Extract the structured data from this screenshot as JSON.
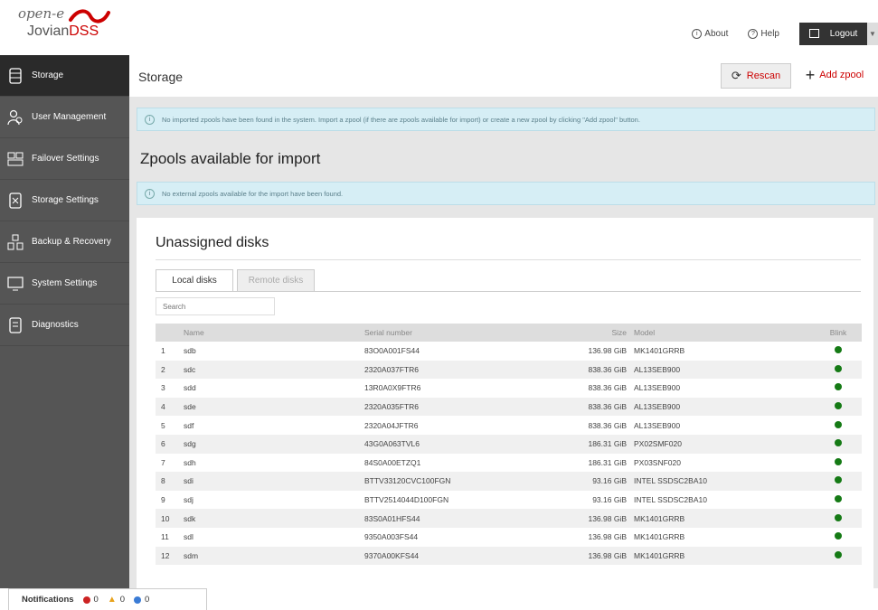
{
  "header": {
    "logo_brand": "open-e",
    "logo_product_prefix": "Jovian",
    "logo_product_suffix": "DSS",
    "about_label": "About",
    "help_label": "Help",
    "logout_label": "Logout"
  },
  "sidebar": {
    "items": [
      {
        "label": "Storage",
        "icon": "storage-icon",
        "active": true
      },
      {
        "label": "User Management",
        "icon": "users-icon",
        "active": false
      },
      {
        "label": "Failover Settings",
        "icon": "failover-icon",
        "active": false
      },
      {
        "label": "Storage Settings",
        "icon": "storage-settings-icon",
        "active": false
      },
      {
        "label": "Backup & Recovery",
        "icon": "backup-icon",
        "active": false
      },
      {
        "label": "System Settings",
        "icon": "system-settings-icon",
        "active": false
      },
      {
        "label": "Diagnostics",
        "icon": "diagnostics-icon",
        "active": false
      }
    ]
  },
  "main": {
    "page_title": "Storage",
    "rescan_label": "Rescan",
    "add_zpool_label": "Add zpool",
    "info_no_imported": "No imported zpools have been found in the system. Import a zpool (if there are zpools available for import) or create a new zpool by clicking \"Add zpool\" button.",
    "section_import_title": "Zpools available for import",
    "info_no_external": "No external zpools available for the import have been found.",
    "unassigned": {
      "title": "Unassigned disks",
      "tabs": [
        "Local disks",
        "Remote disks"
      ],
      "search_placeholder": "Search",
      "columns": [
        "Name",
        "Serial number",
        "Size",
        "Model",
        "Blink"
      ],
      "rows": [
        {
          "no": "1",
          "name": "sdb",
          "serial": "83O0A001FS44",
          "size": "136.98 GiB",
          "model": "MK1401GRRB"
        },
        {
          "no": "2",
          "name": "sdc",
          "serial": "2320A037FTR6",
          "size": "838.36 GiB",
          "model": "AL13SEB900"
        },
        {
          "no": "3",
          "name": "sdd",
          "serial": "13R0A0X9FTR6",
          "size": "838.36 GiB",
          "model": "AL13SEB900"
        },
        {
          "no": "4",
          "name": "sde",
          "serial": "2320A035FTR6",
          "size": "838.36 GiB",
          "model": "AL13SEB900"
        },
        {
          "no": "5",
          "name": "sdf",
          "serial": "2320A04JFTR6",
          "size": "838.36 GiB",
          "model": "AL13SEB900"
        },
        {
          "no": "6",
          "name": "sdg",
          "serial": "43G0A063TVL6",
          "size": "186.31 GiB",
          "model": "PX02SMF020"
        },
        {
          "no": "7",
          "name": "sdh",
          "serial": "84S0A00ETZQ1",
          "size": "186.31 GiB",
          "model": "PX03SNF020"
        },
        {
          "no": "8",
          "name": "sdi",
          "serial": "BTTV33120CVC100FGN",
          "size": "93.16 GiB",
          "model": "INTEL SSDSC2BA10"
        },
        {
          "no": "9",
          "name": "sdj",
          "serial": "BTTV2514044D100FGN",
          "size": "93.16 GiB",
          "model": "INTEL SSDSC2BA10"
        },
        {
          "no": "10",
          "name": "sdk",
          "serial": "83S0A01HFS44",
          "size": "136.98 GiB",
          "model": "MK1401GRRB"
        },
        {
          "no": "11",
          "name": "sdl",
          "serial": "9350A003FS44",
          "size": "136.98 GiB",
          "model": "MK1401GRRB"
        },
        {
          "no": "12",
          "name": "sdm",
          "serial": "9370A00KFS44",
          "size": "136.98 GiB",
          "model": "MK1401GRRB"
        }
      ]
    }
  },
  "notifications": {
    "label": "Notifications",
    "errors": "0",
    "warnings": "0",
    "info": "0",
    "colors": {
      "error": "#cc2222",
      "warning": "#e8a21b",
      "info": "#3a7bd5"
    }
  }
}
